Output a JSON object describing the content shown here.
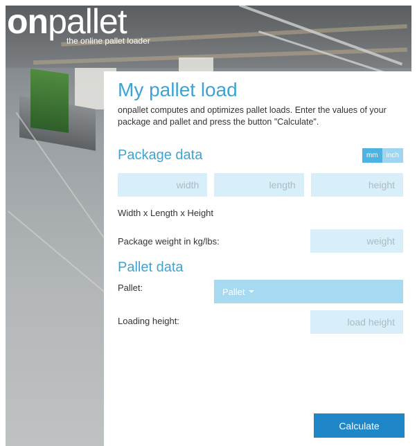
{
  "logo": {
    "word_bold": "on",
    "word_light": "pallet",
    "tagline": "the online pallet loader"
  },
  "panel": {
    "title": "My pallet load",
    "intro": "onpallet computes and optimizes pallet loads. Enter the values of your package and pallet and press the button \"Calculate\"."
  },
  "package": {
    "title": "Package data",
    "unit_mm": "mm",
    "unit_inch": "inch",
    "width_placeholder": "width",
    "length_placeholder": "length",
    "height_placeholder": "height",
    "dims_caption": "Width x Length x Height",
    "weight_label": "Package weight in kg/lbs:",
    "weight_placeholder": "weight"
  },
  "pallet": {
    "title": "Pallet data",
    "pallet_label": "Pallet:",
    "pallet_button": "Pallet",
    "loading_label": "Loading height:",
    "loading_placeholder": "load height"
  },
  "actions": {
    "calculate": "Calculate"
  },
  "colors": {
    "accent": "#3ea3d3",
    "field_bg": "#d8eef9",
    "button": "#1f86c7"
  }
}
